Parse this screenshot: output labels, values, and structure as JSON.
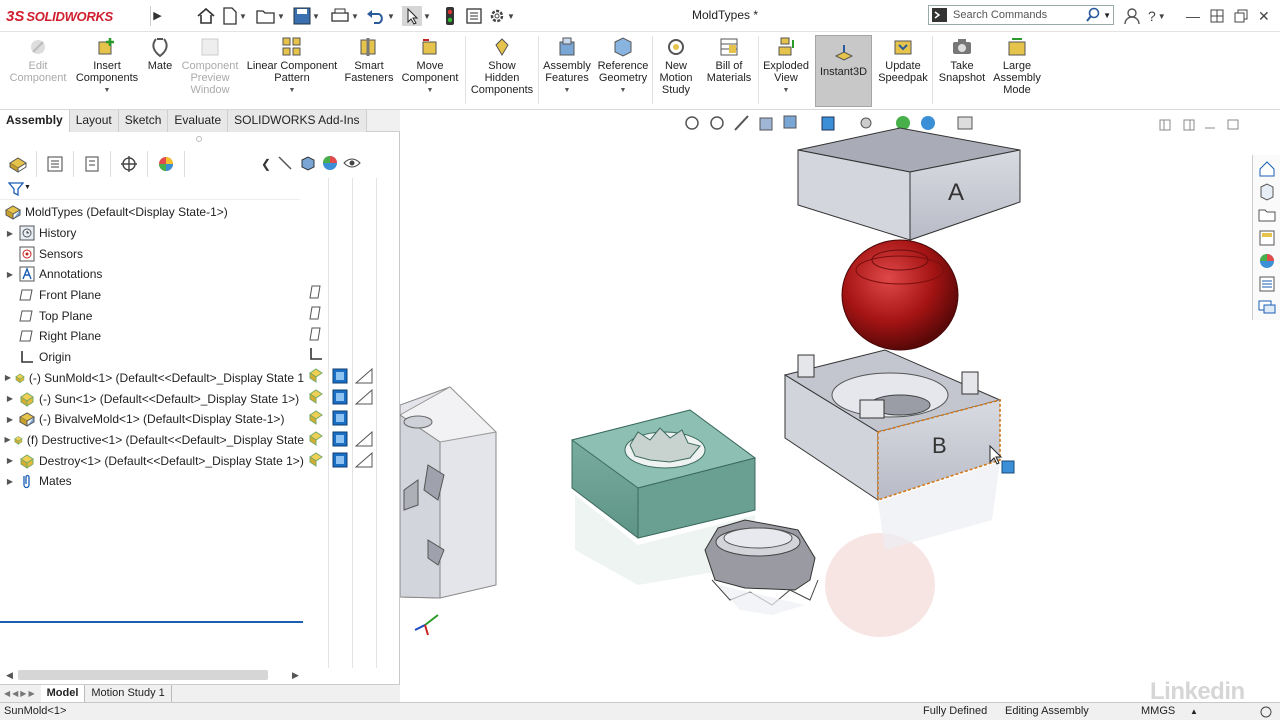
{
  "app": {
    "logo_ds": "3S",
    "logo_name": "SOLIDWORKS",
    "title": "MoldTypes *"
  },
  "search": {
    "placeholder": "Search Commands"
  },
  "commands": [
    {
      "label": "Edit\nComponent",
      "icon": "edit-component-icon",
      "disabled": true
    },
    {
      "label": "Insert\nComponents",
      "icon": "insert-components-icon"
    },
    {
      "label": "Mate",
      "icon": "mate-icon"
    },
    {
      "label": "Component\nPreview\nWindow",
      "icon": "component-preview-icon",
      "disabled": true
    },
    {
      "label": "Linear Component\nPattern",
      "icon": "linear-pattern-icon"
    },
    {
      "label": "Smart\nFasteners",
      "icon": "smart-fasteners-icon"
    },
    {
      "label": "Move\nComponent",
      "icon": "move-component-icon"
    },
    {
      "label": "Show\nHidden\nComponents",
      "icon": "show-hidden-icon"
    },
    {
      "label": "Assembly\nFeatures",
      "icon": "assembly-features-icon"
    },
    {
      "label": "Reference\nGeometry",
      "icon": "reference-geometry-icon"
    },
    {
      "label": "New\nMotion\nStudy",
      "icon": "motion-study-icon"
    },
    {
      "label": "Bill of\nMaterials",
      "icon": "bom-icon"
    },
    {
      "label": "Exploded\nView",
      "icon": "exploded-view-icon"
    },
    {
      "label": "Instant3D",
      "icon": "instant3d-icon",
      "active": true
    },
    {
      "label": "Update\nSpeedpak",
      "icon": "speedpak-icon"
    },
    {
      "label": "Take\nSnapshot",
      "icon": "snapshot-icon"
    },
    {
      "label": "Large\nAssembly\nMode",
      "icon": "large-assembly-icon"
    }
  ],
  "tabs": [
    "Assembly",
    "Layout",
    "Sketch",
    "Evaluate",
    "SOLIDWORKS Add-Ins"
  ],
  "tree": {
    "root": "MoldTypes  (Default<Display State-1>)",
    "items": [
      {
        "label": "History",
        "expandable": true
      },
      {
        "label": "Sensors",
        "expandable": false
      },
      {
        "label": "Annotations",
        "expandable": true
      },
      {
        "label": "Front Plane",
        "expandable": false
      },
      {
        "label": "Top Plane",
        "expandable": false
      },
      {
        "label": "Right Plane",
        "expandable": false
      },
      {
        "label": "Origin",
        "expandable": false
      },
      {
        "label": "(-) SunMold<1> (Default<<Default>_Display State 1",
        "expandable": true
      },
      {
        "label": "(-) Sun<1> (Default<<Default>_Display State 1>)",
        "expandable": true
      },
      {
        "label": "(-) BivalveMold<1> (Default<Display State-1>)",
        "expandable": true
      },
      {
        "label": "(f) Destructive<1> (Default<<Default>_Display State",
        "expandable": true
      },
      {
        "label": "Destroy<1> (Default<<Default>_Display State 1>)",
        "expandable": true
      },
      {
        "label": "Mates",
        "expandable": true
      }
    ]
  },
  "bottom_tabs": [
    "Model",
    "Motion Study 1"
  ],
  "status": {
    "left": "SunMold<1>",
    "defined": "Fully Defined",
    "mode": "Editing Assembly",
    "units": "MMGS"
  },
  "viewport": {
    "face_a": "A",
    "face_b": "B"
  },
  "watermark": "Linkedin",
  "colors": {
    "accent": "#1a5fb4",
    "sphere": "#b01818",
    "teal_mold": "#6fa89a",
    "instant3d_bg": "#c8c8c8"
  }
}
